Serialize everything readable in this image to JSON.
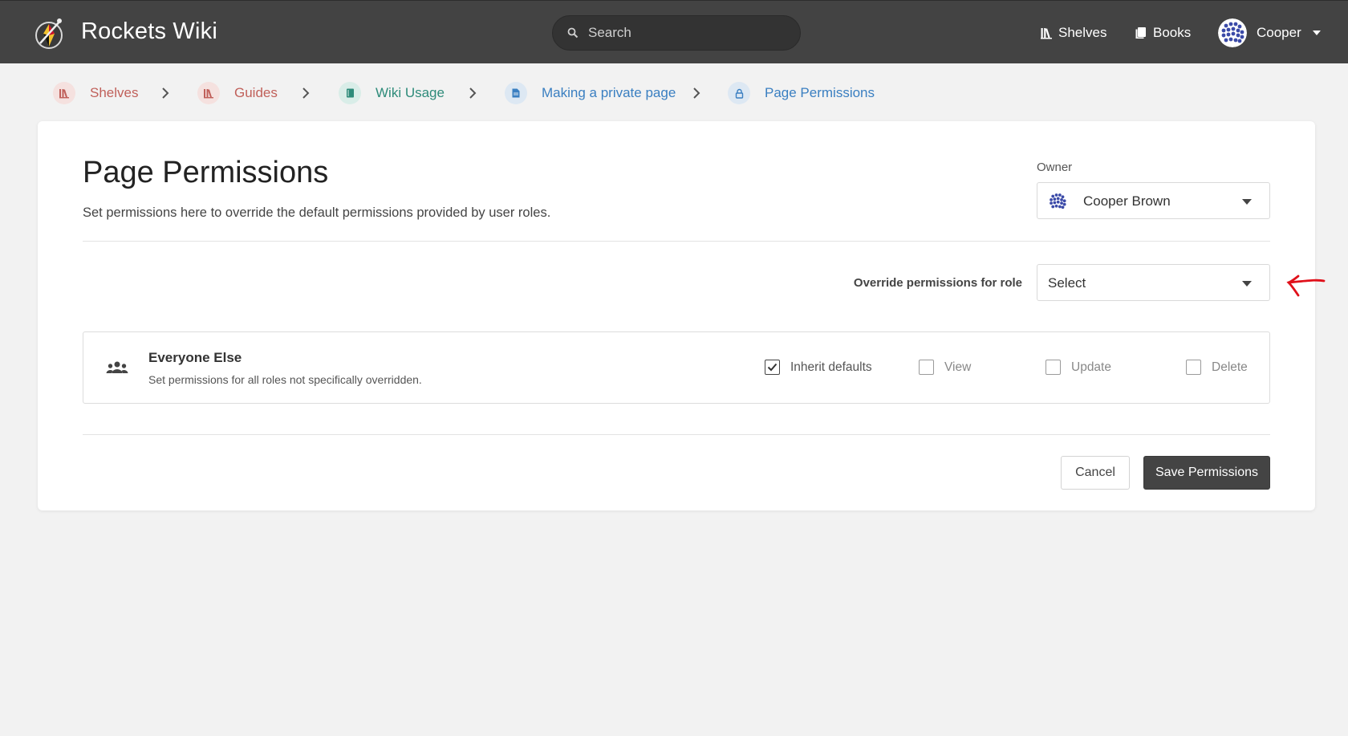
{
  "app": {
    "title": "Rockets Wiki"
  },
  "header": {
    "search_placeholder": "Search",
    "nav": [
      {
        "label": "Shelves",
        "icon": "shelves-icon"
      },
      {
        "label": "Books",
        "icon": "books-icon"
      }
    ],
    "user": {
      "name": "Cooper",
      "avatar": "user-avatar"
    }
  },
  "breadcrumb": [
    {
      "label": "Shelves",
      "icon": "shelves-icon",
      "color": "#c0605a"
    },
    {
      "label": "Guides",
      "icon": "shelf-icon",
      "color": "#c0605a"
    },
    {
      "label": "Wiki Usage",
      "icon": "book-icon",
      "color": "#2e8b7a"
    },
    {
      "label": "Making a private page",
      "icon": "page-icon",
      "color": "#3a7fc1"
    },
    {
      "label": "Page Permissions",
      "icon": "lock-icon",
      "color": "#3a7fc1"
    }
  ],
  "main": {
    "title": "Page Permissions",
    "description": "Set permissions here to override the default permissions provided by user roles.",
    "owner": {
      "label": "Owner",
      "value": "Cooper Brown"
    },
    "override": {
      "label": "Override permissions for role",
      "value": "Select"
    },
    "everyone_else": {
      "name": "Everyone Else",
      "description": "Set permissions for all roles not specifically overridden.",
      "checkboxes": [
        {
          "label": "Inherit defaults",
          "checked": true
        },
        {
          "label": "View",
          "checked": false
        },
        {
          "label": "Update",
          "checked": false
        },
        {
          "label": "Delete",
          "checked": false
        }
      ]
    },
    "actions": {
      "cancel": "Cancel",
      "save": "Save Permissions"
    }
  },
  "colors": {
    "header": "#434343",
    "primary_button": "#444444",
    "annotation": "#e0101a"
  }
}
